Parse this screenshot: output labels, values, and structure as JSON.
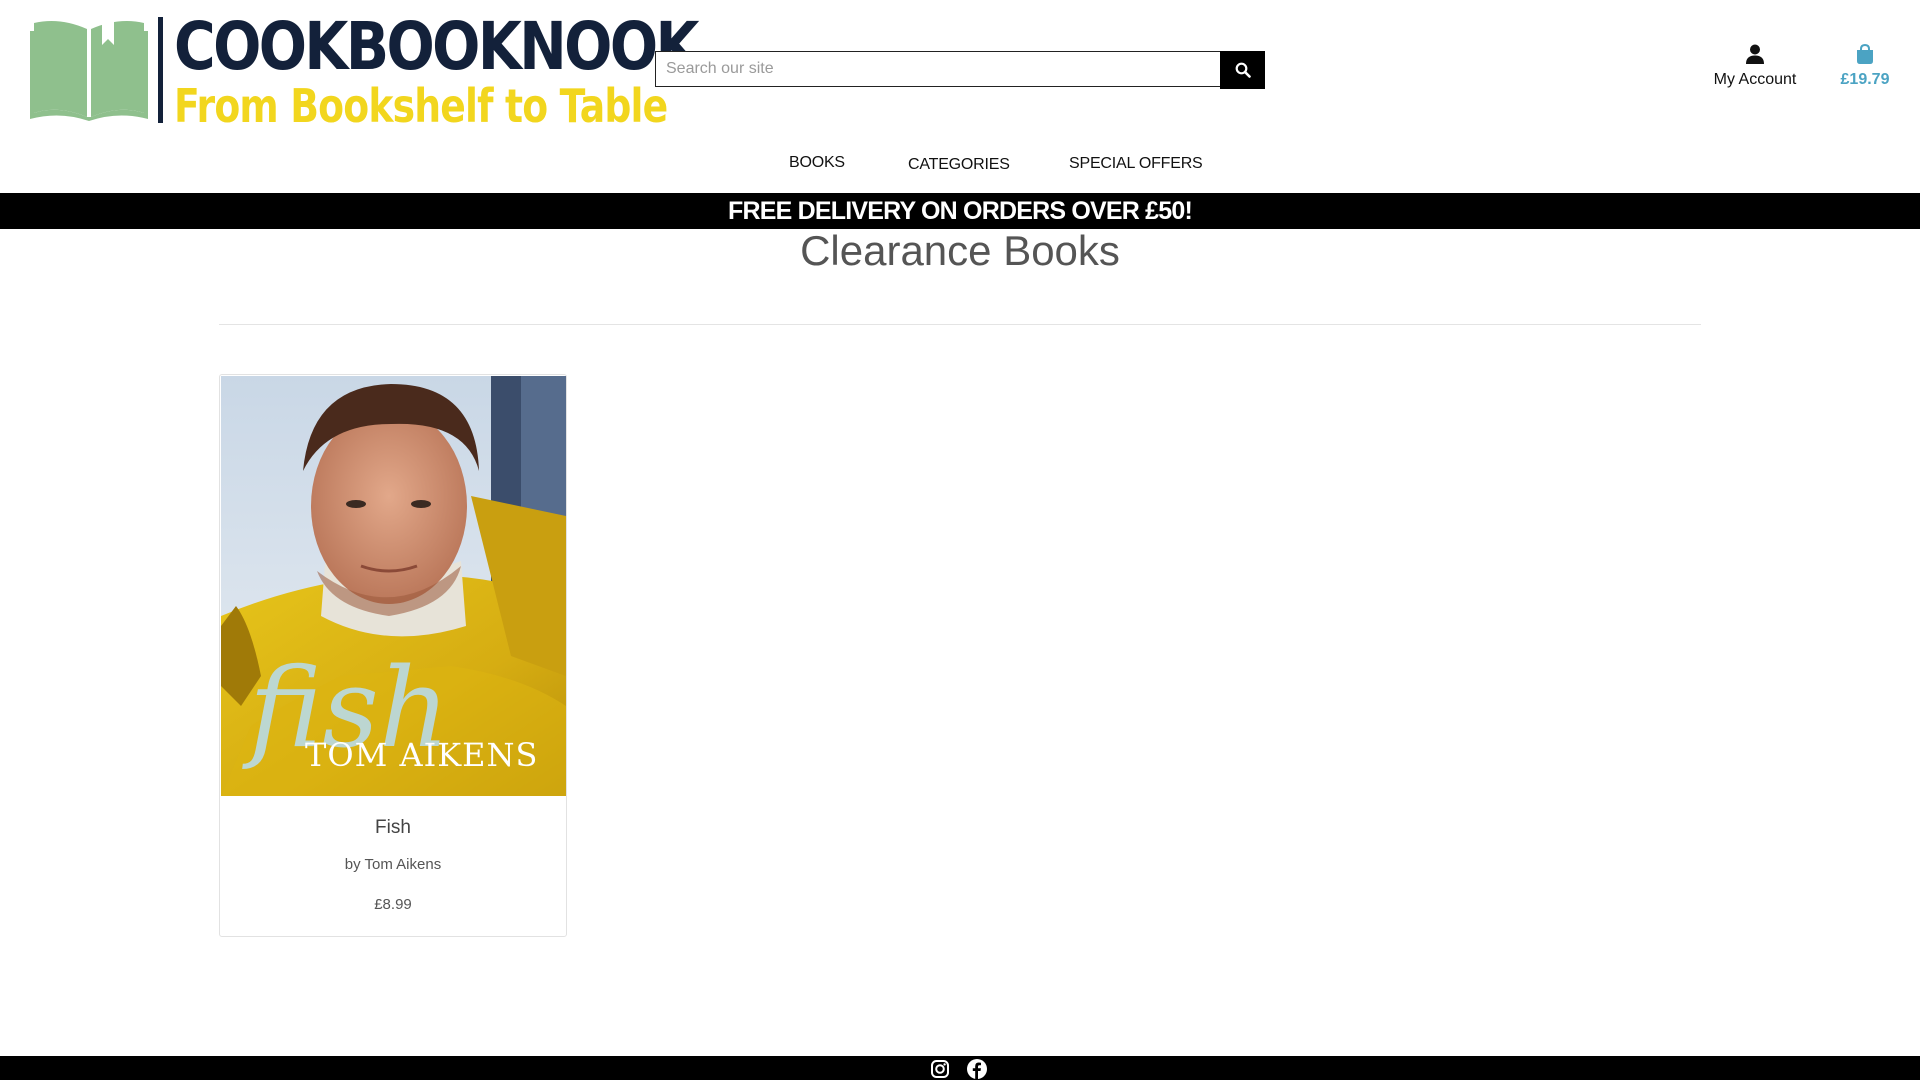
{
  "brand": {
    "name": "COOKBOOKNOOK",
    "tagline": "From Bookshelf to Table",
    "colors": {
      "navy": "#13213a",
      "yellow": "#f2d61e",
      "green": "#8fc08d",
      "accent": "#4ba3c3"
    }
  },
  "search": {
    "placeholder": "Search our site",
    "value": "",
    "icon": "search-icon"
  },
  "account": {
    "label": "My Account",
    "icon": "user-icon"
  },
  "bag": {
    "total": "£19.79",
    "icon": "shopping-bag-icon"
  },
  "nav": {
    "items": [
      {
        "label": "Books"
      },
      {
        "label": "Categories"
      },
      {
        "label": "Special Offers"
      }
    ]
  },
  "banner": {
    "text": "FREE DELIVERY ON ORDERS OVER £50!"
  },
  "page": {
    "title": "Clearance Books"
  },
  "products": [
    {
      "title": "Fish",
      "author": "by Tom Aikens",
      "price": "£8.99",
      "cover": {
        "title_text": "fish",
        "author_text": "TOM AIKENS"
      }
    }
  ],
  "footer": {
    "social": [
      "instagram-icon",
      "facebook-icon"
    ]
  }
}
